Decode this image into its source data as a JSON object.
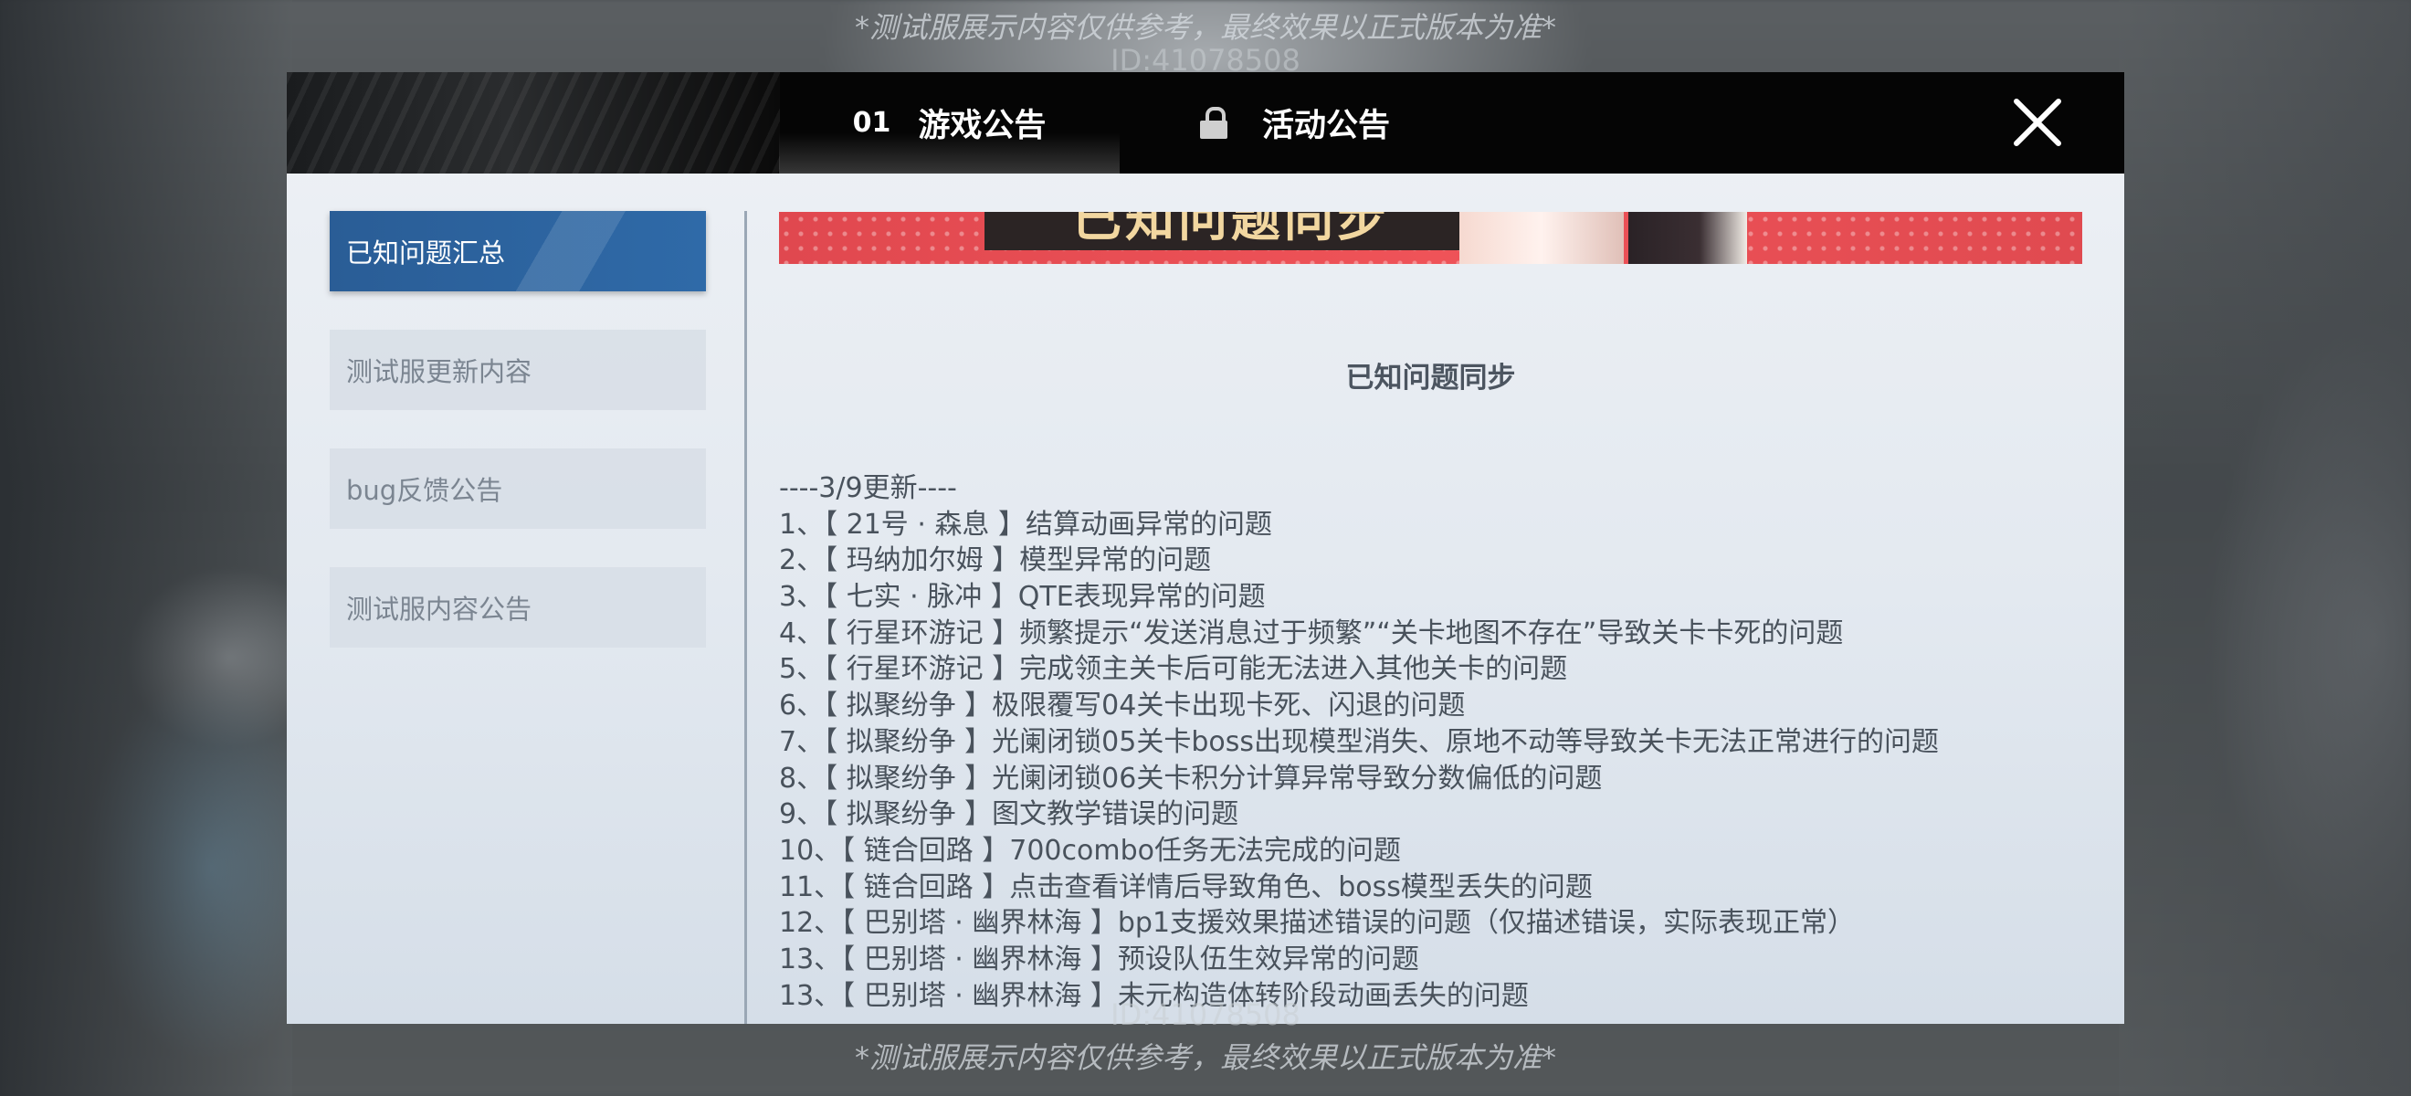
{
  "watermark": {
    "disclaimer": "*测试服展示内容仅供参考，最终效果以正式版本为准*",
    "id": "ID:41078508"
  },
  "header": {
    "tabs": [
      {
        "number": "01",
        "label": "游戏公告",
        "active": true
      },
      {
        "label": "活动公告",
        "icon": "lock-icon",
        "active": false
      }
    ],
    "close_icon": "close-icon"
  },
  "sidebar": {
    "items": [
      {
        "label": "已知问题汇总",
        "active": true
      },
      {
        "label": "测试服更新内容",
        "active": false
      },
      {
        "label": "bug反馈公告",
        "active": false
      },
      {
        "label": "测试服内容公告",
        "active": false
      }
    ]
  },
  "content": {
    "banner_text": "已知问题同步",
    "title": "已知问题同步",
    "lines": [
      "----3/9更新----",
      "1、【 21号 · 森息 】结算动画异常的问题",
      "2、【 玛纳加尔姆 】模型异常的问题",
      "3、【 七实 · 脉冲 】QTE表现异常的问题",
      "4、【 行星环游记 】频繁提示“发送消息过于频繁”“关卡地图不存在”导致关卡卡死的问题",
      "5、【 行星环游记 】完成领主关卡后可能无法进入其他关卡的问题",
      "6、【 拟聚纷争 】极限覆写04关卡出现卡死、闪退的问题",
      "7、【 拟聚纷争 】光阑闭锁05关卡boss出现模型消失、原地不动等导致关卡无法正常进行的问题",
      "8、【 拟聚纷争 】光阑闭锁06关卡积分计算异常导致分数偏低的问题",
      "9、【 拟聚纷争 】图文教学错误的问题",
      "10、【 链合回路 】700combo任务无法完成的问题",
      "11、【 链合回路 】点击查看详情后导致角色、boss模型丢失的问题",
      "12、【 巴别塔 · 幽界林海 】bp1支援效果描述错误的问题（仅描述错误，实际表现正常）",
      "13、【 巴别塔 · 幽界林海 】预设队伍生效异常的问题",
      "13、【 巴别塔 · 幽界林海 】未元构造体转阶段动画丢失的问题"
    ]
  },
  "colors": {
    "active_tab_bg": "#2f6aa8",
    "header_bg": "#050505",
    "banner_red": "#ef5358",
    "body_text": "#49525c"
  }
}
